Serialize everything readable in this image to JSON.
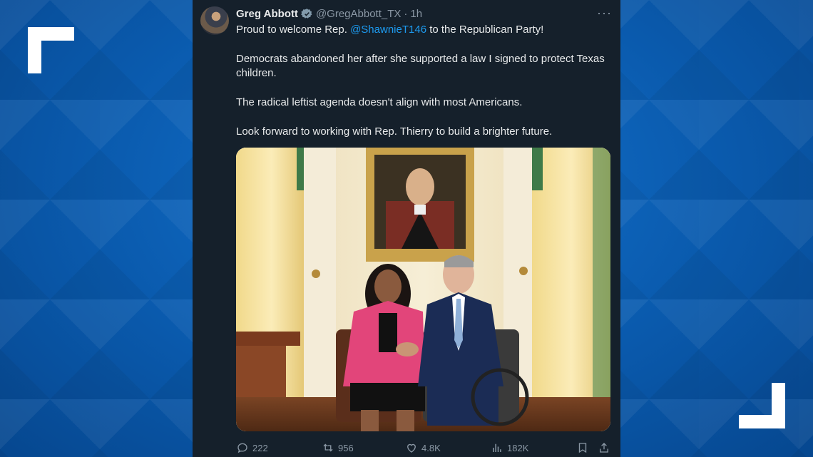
{
  "tweet": {
    "author_name": "Greg Abbott",
    "handle": "@GregAbbott_TX",
    "separator": "·",
    "time": "1h",
    "more_label": "···",
    "line1_pre": "Proud to welcome Rep. ",
    "mention": "@ShawnieT146",
    "line1_post": " to the Republican Party!",
    "para2": "Democrats abandoned her after she supported a law I signed to protect Texas children.",
    "para3": "The radical leftist agenda doesn't align with most Americans.",
    "para4": "Look forward to working with Rep. Thierry to build a brighter future."
  },
  "stats": {
    "replies": "222",
    "retweets": "956",
    "likes": "4.8K",
    "views": "182K"
  },
  "icons": [
    "verified-badge-icon",
    "reply-icon",
    "retweet-icon",
    "like-icon",
    "views-icon",
    "bookmark-icon",
    "share-icon"
  ],
  "colors": {
    "tweet_bg": "#15202b",
    "text": "#e7e9ea",
    "muted": "#8b98a5",
    "link": "#1d9bf0",
    "background_blue": "#0a57a8"
  }
}
